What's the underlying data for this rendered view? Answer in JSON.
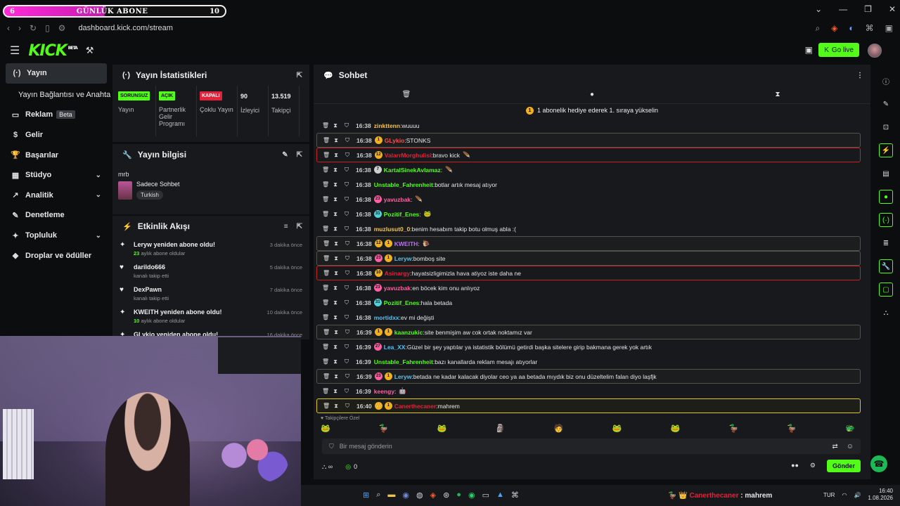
{
  "subgoal": {
    "left": "6",
    "label": "GÜNLÜK ABONE",
    "right": "10"
  },
  "window": {
    "min": "⌄",
    "minimize": "—",
    "restore": "❐",
    "close": "✕"
  },
  "browser": {
    "url": "dashboard.kick.com/stream"
  },
  "header": {
    "logo": "KICK",
    "logo_sup": "BETA",
    "go_live": "Go live"
  },
  "nav": [
    {
      "label": "Yayın",
      "icon": "(·)",
      "active": true
    },
    {
      "label": "Yayın Bağlantısı ve Anahtarı",
      "sub": true
    },
    {
      "label": "Reklam",
      "icon": "▭",
      "badge": "Beta"
    },
    {
      "label": "Gelir",
      "icon": "$"
    },
    {
      "label": "Başarılar",
      "icon": "🏆"
    },
    {
      "label": "Stüdyo",
      "icon": "▦",
      "chev": "⌄"
    },
    {
      "label": "Analitik",
      "icon": "↗",
      "chev": "⌄"
    },
    {
      "label": "Denetleme",
      "icon": "✎"
    },
    {
      "label": "Topluluk",
      "icon": "✦",
      "chev": "⌄"
    },
    {
      "label": "Droplar ve ödüller",
      "icon": "◆"
    }
  ],
  "stats": {
    "title": "Yayın İstatistikleri",
    "items": [
      {
        "pill": "SORUNSUZ",
        "pill_color": "#53fc18",
        "label": "Yayın"
      },
      {
        "pill": "AÇIK",
        "pill_color": "#53fc18",
        "label": "Partnerlik Gelir Programı"
      },
      {
        "pill": "KAPALI",
        "pill_color": "#e0233b",
        "label": "Çoklu Yayın"
      },
      {
        "num": "90",
        "label": "İzleyici"
      },
      {
        "num": "13.519",
        "label": "Takipçi"
      }
    ]
  },
  "info": {
    "title": "Yayın bilgisi",
    "stream_title": "mrb",
    "category": "Sadece Sohbet",
    "tag": "Turkish"
  },
  "events": {
    "title": "Etkinlik Akışı",
    "items": [
      {
        "icon": "✦",
        "title": "Leryw yeniden abone oldu!",
        "count": "23",
        "sub": "aylık abone oldular",
        "time": "3 dakika önce"
      },
      {
        "icon": "♥",
        "title": "darildo666",
        "sub": "kanalı takip etti",
        "time": "5 dakika önce"
      },
      {
        "icon": "♥",
        "title": "DexPawn",
        "sub": "kanalı takip etti",
        "time": "7 dakika önce"
      },
      {
        "icon": "✦",
        "title": "KWEITH yeniden abone oldu!",
        "count": "10",
        "sub": "aylık abone oldular",
        "time": "10 dakika önce"
      },
      {
        "icon": "✦",
        "title": "GLykio yeniden abone oldu!",
        "sub": "",
        "time": "16 dakika önce"
      }
    ]
  },
  "chat": {
    "title": "Sohbet",
    "pinned": "1 abonelik hediye ederek 1. sıraya yükselin",
    "messages": [
      {
        "time": "16:38",
        "user": "zinkttenn",
        "color": "#f5c542",
        "text": "wuuuu",
        "style": ""
      },
      {
        "time": "16:38",
        "badges": [
          "1"
        ],
        "user": "GLykio",
        "color": "#ff4d4d",
        "text": "STONKS",
        "style": "sub"
      },
      {
        "time": "16:38",
        "badges": [
          "12"
        ],
        "user": "ValarrMorghulisi",
        "color": "#e0233b",
        "text": "bravo kick",
        "emo": "🪶",
        "style": "red"
      },
      {
        "time": "16:38",
        "badges": [
          "7"
        ],
        "user": "KartalSinekAvlamaz",
        "color": "#53fc18",
        "text": "",
        "emo": "🪶",
        "style": ""
      },
      {
        "time": "16:38",
        "user": "Unstable_Fahrenheit",
        "color": "#53fc18",
        "text": "botlar artık mesaj atıyor",
        "style": ""
      },
      {
        "time": "16:38",
        "badges": [
          "23"
        ],
        "user": "yavuzbak",
        "color": "#ff5fa2",
        "text": "",
        "emo": "🪶",
        "style": ""
      },
      {
        "time": "16:38",
        "badges": [
          "31"
        ],
        "user": "Pozitif_Enes",
        "color": "#53fc18",
        "text": "",
        "emo": "🐸",
        "style": ""
      },
      {
        "time": "16:38",
        "user": "muzlusut0_0",
        "color": "#f5c542",
        "text": "benim hesabım takip botu olmuş abla :(",
        "style": ""
      },
      {
        "time": "16:38",
        "badges": [
          "12",
          "1"
        ],
        "user": "KWEITH",
        "color": "#c06bff",
        "text": "",
        "emo": "🐌",
        "style": "sub"
      },
      {
        "time": "16:38",
        "badges": [
          "23",
          "1"
        ],
        "user": "Leryw",
        "color": "#4fc3f7",
        "text": "bomboş site",
        "style": "sub"
      },
      {
        "time": "16:38",
        "badges": [
          "10"
        ],
        "user": "Asinargy",
        "color": "#e0233b",
        "text": "hayatsizligimizla hava atiyoz iste daha ne",
        "style": "red"
      },
      {
        "time": "16:38",
        "badges": [
          "23"
        ],
        "user": "yavuzbak",
        "color": "#ff5fa2",
        "text": "en böcek kim onu anlıyoz",
        "style": ""
      },
      {
        "time": "16:38",
        "badges": [
          "31"
        ],
        "user": "Pozitif_Enes",
        "color": "#53fc18",
        "text": "hala betada",
        "style": ""
      },
      {
        "time": "16:38",
        "user": "mortidxx",
        "color": "#4fc3f7",
        "text": "ev mi değişti",
        "style": ""
      },
      {
        "time": "16:39",
        "badges": [
          "1",
          "1"
        ],
        "user": "kaanzukic",
        "color": "#53fc18",
        "text": "site benmişim aw cok ortak noktamız var",
        "style": "sub"
      },
      {
        "time": "16:39",
        "badges": [
          "27"
        ],
        "user": "Lea_XX",
        "color": "#4fc3f7",
        "text": "Güzel bir şey yaptılar ya istatistik bölümü getirdi başka sitelere girip bakmana gerek yok artık",
        "style": ""
      },
      {
        "time": "16:39",
        "user": "Unstable_Fahrenheit",
        "color": "#53fc18",
        "text": "bazı kanallarda reklam mesajı atıyorlar",
        "style": ""
      },
      {
        "time": "16:39",
        "badges": [
          "23",
          "1"
        ],
        "user": "Leryw",
        "color": "#4fc3f7",
        "text": "betada ne kadar kalacak diyolar ceo ya aa betada mıydık biz onu düzeltelim falan diyo laşfjk",
        "style": "sub"
      },
      {
        "time": "16:39",
        "user": "keengy",
        "color": "#ff5fa2",
        "text": "",
        "emo": "🤖",
        "style": ""
      },
      {
        "time": "16:40",
        "badges": [
          "👑",
          "1"
        ],
        "user": "Canerthecaner",
        "color": "#e0233b",
        "text": "mahrem",
        "style": "yel"
      }
    ],
    "emote_label": "♥ Takipçilere Özel",
    "emotes": [
      "🐸",
      "🦆",
      "🐸",
      "🗿",
      "🧑",
      "🐸",
      "🐸",
      "🦆",
      "🦆",
      "🐲"
    ],
    "input_placeholder": "Bir mesaj gönderin",
    "viewer_count": "0",
    "send": "Gönder"
  },
  "taskbar": {
    "lang": "TUR",
    "time": "16:40",
    "date": "1.08.2026"
  },
  "subalert": {
    "user": "Canerthecaner",
    "text": ": mahrem"
  }
}
